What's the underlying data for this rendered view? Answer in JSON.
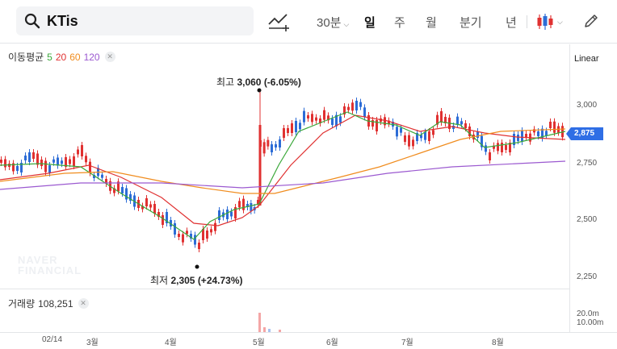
{
  "search": {
    "query": "KTis"
  },
  "toolbar": {
    "timeframes": {
      "min30": "30분",
      "day": "일",
      "week": "주",
      "month": "월",
      "quarter": "분기",
      "year": "년"
    },
    "active": "일"
  },
  "legend": {
    "ma_label": "이동평균",
    "ma_periods": [
      {
        "period": "5",
        "color": "#3aa83a"
      },
      {
        "period": "20",
        "color": "#e03131"
      },
      {
        "period": "60",
        "color": "#f08c1e"
      },
      {
        "period": "120",
        "color": "#9b59d0"
      }
    ],
    "volume_label": "거래량",
    "volume_value": "108,251"
  },
  "scale_mode": "Linear",
  "price_axis": {
    "ticks": [
      "3,000",
      "2,750",
      "2,500",
      "2,250"
    ],
    "current_price": "2,875",
    "current_price_color": "#2f6ee5"
  },
  "volume_axis": {
    "ticks": [
      "20.0m",
      "10.00m"
    ]
  },
  "date_axis": {
    "ticks": [
      "02/14",
      "3월",
      "4월",
      "5월",
      "6월",
      "7월",
      "8월"
    ]
  },
  "annotations": {
    "high": {
      "label": "최고",
      "value": "3,060",
      "change": "(-6.05%)"
    },
    "low": {
      "label": "최저",
      "value": "2,305",
      "change": "(+24.73%)"
    }
  },
  "watermark": [
    "NAVER",
    "FINANCIAL"
  ],
  "colors": {
    "up": "#e03131",
    "down": "#2c6cd6"
  }
}
